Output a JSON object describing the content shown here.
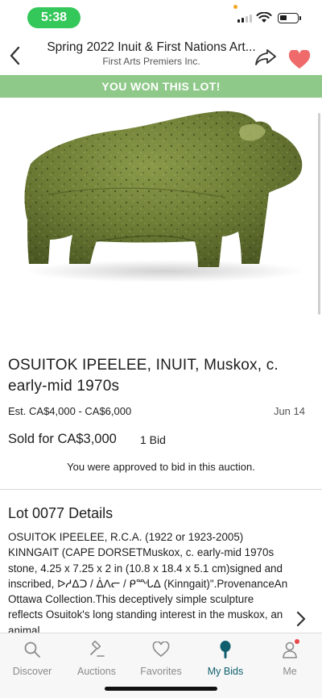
{
  "status_bar": {
    "time": "5:38"
  },
  "header": {
    "title": "Spring 2022 Inuit & First Nations Art...",
    "subtitle": "First Arts Premiers Inc."
  },
  "banner": {
    "text": "YOU WON THIS LOT!"
  },
  "hero": {
    "subject": "green stone muskox sculpture"
  },
  "lot": {
    "title": "OSUITOK IPEELEE, INUIT, Muskox, c. early-mid 1970s",
    "estimate": "Est. CA$4,000 - CA$6,000",
    "date": "Jun 14",
    "sold_price": "Sold for CA$3,000",
    "bid_count": "1 Bid",
    "approval_note": "You were approved to bid in this auction."
  },
  "details": {
    "heading": "Lot 0077 Details",
    "body": "OSUITOK IPEELEE, R.C.A. (1922 or 1923-2005) KINNGAIT (CAPE DORSETMuskox, c. early-mid 1970s stone, 4.25 x 7.25 x 2 in (10.8 x 18.4 x 5.1 cm)signed and inscribed, ᐅᓱᐃᑐ / ᐄᐱᓕ / ᑭᙵᐃ (Kinngait)\".ProvenanceAn Ottawa Collection.This deceptively simple sculpture reflects Osuitok's long standing interest in the muskox, an animal"
  },
  "tabs": [
    {
      "label": "Discover",
      "icon": "search-icon",
      "active": false
    },
    {
      "label": "Auctions",
      "icon": "gavel-icon",
      "active": false
    },
    {
      "label": "Favorites",
      "icon": "heart-icon",
      "active": false
    },
    {
      "label": "My Bids",
      "icon": "paddle-icon",
      "active": true
    },
    {
      "label": "Me",
      "icon": "person-icon",
      "active": false
    }
  ],
  "colors": {
    "status_green": "#34c759",
    "banner_green": "#8fc98a",
    "heart_red": "#ef6b6b",
    "active_tab": "#0f5e6e",
    "inactive_tab": "#8a8a8a"
  }
}
